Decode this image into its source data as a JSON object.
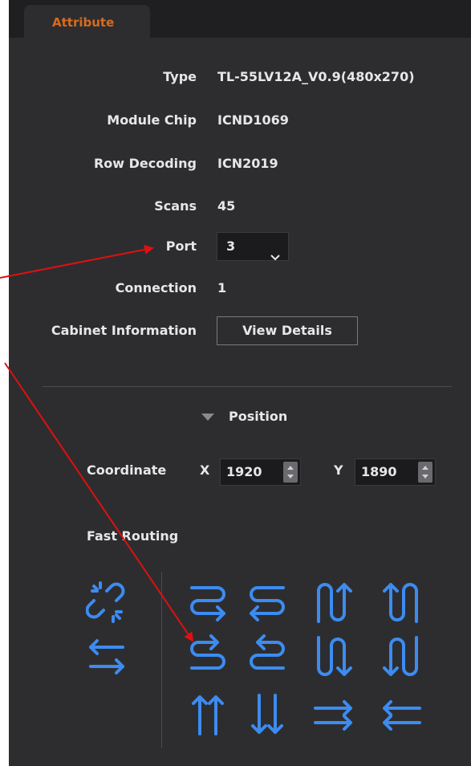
{
  "tab": {
    "label": "Attribute"
  },
  "attributes": {
    "type_label": "Type",
    "type_value": "TL-55LV12A_V0.9(480x270)",
    "module_chip_label": "Module Chip",
    "module_chip_value": "ICND1069",
    "row_decoding_label": "Row Decoding",
    "row_decoding_value": "ICN2019",
    "scans_label": "Scans",
    "scans_value": "45",
    "port_label": "Port",
    "port_value": "3",
    "connection_label": "Connection",
    "connection_value": "1",
    "cabinet_label": "Cabinet Information",
    "view_details_label": "View Details"
  },
  "position": {
    "section_label": "Position",
    "coordinate_label": "Coordinate",
    "x_label": "X",
    "x_value": "1920",
    "y_label": "Y",
    "y_value": "1890"
  },
  "routing": {
    "label": "Fast Routing",
    "icons": [
      "unlink-icon",
      "swap-arrows-icon",
      "serpentine-right-icon",
      "serpentine-left-icon",
      "serpentine-up-icon",
      "serpentine-up-reverse-icon",
      "serpentine-right-down-icon",
      "serpentine-left-down-icon",
      "serpentine-down-icon",
      "serpentine-down-reverse-icon",
      "double-up-arrow-icon",
      "double-down-arrow-icon",
      "double-right-arrow-icon",
      "double-left-arrow-icon"
    ]
  },
  "colors": {
    "accent": "#d96b1c",
    "icon": "#3c8cf0",
    "annotation": "#e01010",
    "panel": "#2d2d30"
  }
}
